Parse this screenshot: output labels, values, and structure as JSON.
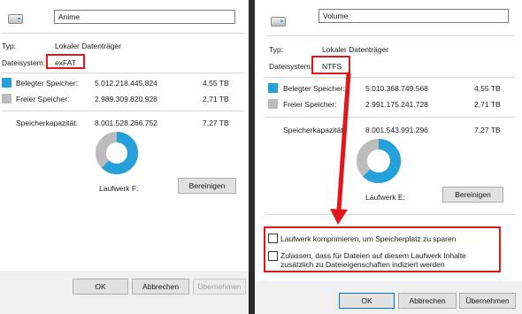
{
  "colors": {
    "used": "#26a0da",
    "free": "#bcbcbc",
    "highlight": "#e0161a"
  },
  "left": {
    "name_value": "Anime",
    "type_label": "Typ:",
    "type_value": "Lokaler Datenträger",
    "fs_label": "Dateisystem:",
    "fs_value": "exFAT",
    "used_label": "Belegter Speicher:",
    "used_bytes": "5.012.218.445.824",
    "used_size": "4,55 TB",
    "free_label": "Freier Speicher:",
    "free_bytes": "2.989.309.820.928",
    "free_size": "2,71 TB",
    "cap_label": "Speicherkapazität:",
    "cap_bytes": "8.001.528.266.752",
    "cap_size": "7,27 TB",
    "drive_label": "Laufwerk F:",
    "cleanup": "Bereinigen",
    "used_fraction": 0.626,
    "ok": "OK",
    "cancel": "Abbrechen",
    "apply": "Übernehmen"
  },
  "right": {
    "name_value": "Volume",
    "type_label": "Typ:",
    "type_value": "Lokaler Datenträger",
    "fs_label": "Dateisystem:",
    "fs_value": "NTFS",
    "used_label": "Belegter Speicher:",
    "used_bytes": "5.010.368.749.568",
    "used_size": "4,55 TB",
    "free_label": "Freier Speicher:",
    "free_bytes": "2.991.175.241.728",
    "free_size": "2,71 TB",
    "cap_label": "Speicherkapazität:",
    "cap_bytes": "8.001.543.991.296",
    "cap_size": "7,27 TB",
    "drive_label": "Laufwerk E:",
    "cleanup": "Bereinigen",
    "used_fraction": 0.626,
    "compress_label": "Laufwerk komprimieren, um Speicherplatz zu sparen",
    "index_label_1": "Zulassen, dass für Dateien auf diesem Laufwerk Inhalte",
    "index_label_2": "zusätzlich zu Dateieigenschaften indiziert werden",
    "ok": "OK",
    "cancel": "Abbrechen",
    "apply": "Übernehmen"
  }
}
